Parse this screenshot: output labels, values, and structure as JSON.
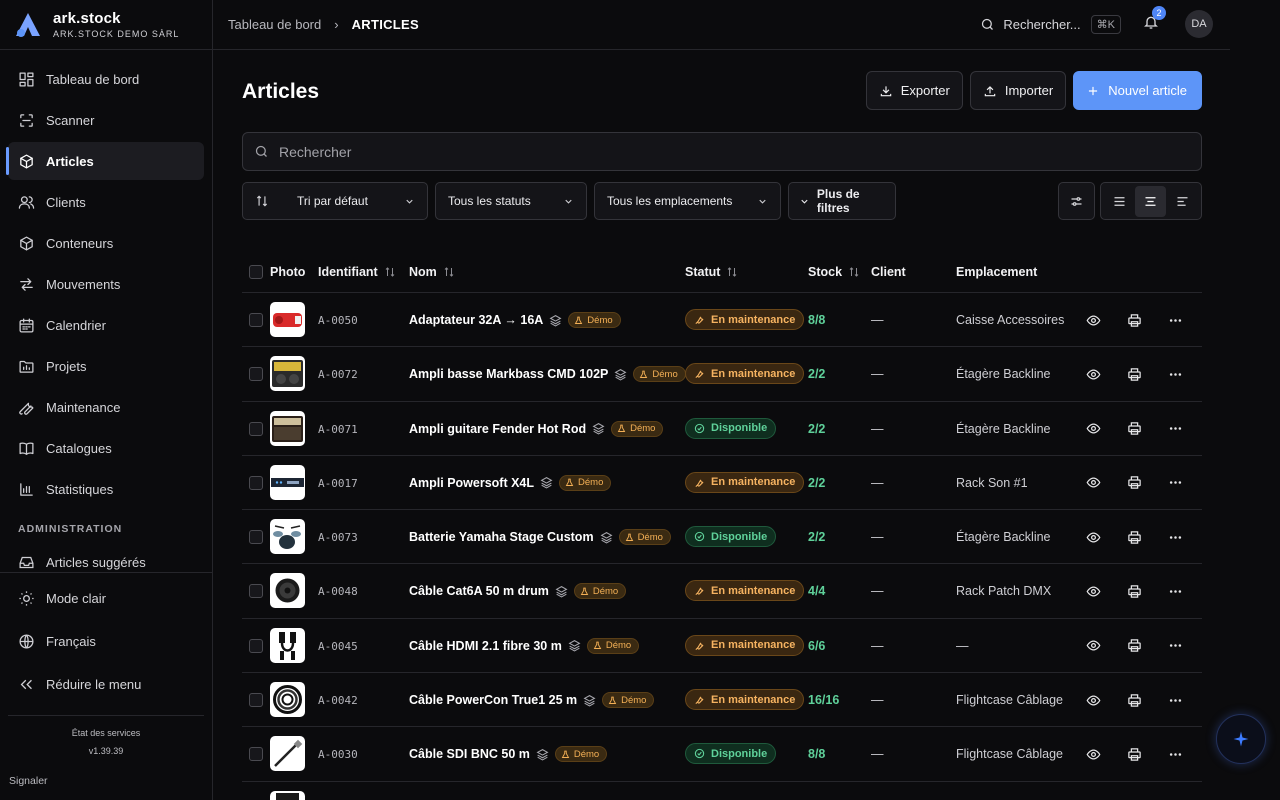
{
  "brand": {
    "name": "ark.stock",
    "subtitle": "ARK.STOCK DEMO SÀRL"
  },
  "sidebar": {
    "items": [
      {
        "label": "Tableau de bord",
        "icon": "dashboard-icon"
      },
      {
        "label": "Scanner",
        "icon": "scan-icon"
      },
      {
        "label": "Articles",
        "icon": "box-icon",
        "active": true
      },
      {
        "label": "Clients",
        "icon": "users-icon"
      },
      {
        "label": "Conteneurs",
        "icon": "container-icon"
      },
      {
        "label": "Mouvements",
        "icon": "arrows-icon"
      },
      {
        "label": "Calendrier",
        "icon": "calendar-icon"
      },
      {
        "label": "Projets",
        "icon": "folder-icon"
      },
      {
        "label": "Maintenance",
        "icon": "wrench-icon"
      },
      {
        "label": "Catalogues",
        "icon": "book-icon"
      },
      {
        "label": "Statistiques",
        "icon": "chart-icon"
      }
    ],
    "admin_section": "ADMINISTRATION",
    "admin_items": [
      {
        "label": "Articles suggérés",
        "icon": "inbox-icon"
      }
    ],
    "bottom": {
      "theme": "Mode clair",
      "language": "Français",
      "collapse": "Réduire le menu"
    },
    "service_status": "État des services",
    "version": "v1.39.39",
    "report": "Signaler"
  },
  "topbar": {
    "breadcrumb_root": "Tableau de bord",
    "breadcrumb_current": "ARTICLES",
    "search_label": "Rechercher...",
    "shortcut": "⌘K",
    "notifications": "2",
    "avatar": "DA"
  },
  "page": {
    "title": "Articles",
    "export_label": "Exporter",
    "import_label": "Importer",
    "new_label": "Nouvel article",
    "search_placeholder": "Rechercher"
  },
  "filters": {
    "sort": "Tri par défaut",
    "status": "Tous les statuts",
    "location": "Tous les emplacements",
    "more": "Plus de filtres"
  },
  "table": {
    "columns": {
      "photo": "Photo",
      "id": "Identifiant",
      "name": "Nom",
      "status": "Statut",
      "stock": "Stock",
      "client": "Client",
      "location": "Emplacement"
    },
    "demo_badge": "Démo",
    "rows": [
      {
        "id": "A-0050",
        "name": "Adaptateur 32A → 16A",
        "status": "En maintenance",
        "status_kind": "maint",
        "stock": "8/8",
        "client": "—",
        "location": "Caisse Accessoires",
        "thumb": "adapter"
      },
      {
        "id": "A-0072",
        "name": "Ampli basse Markbass CMD 102P",
        "status": "En maintenance",
        "status_kind": "maint",
        "stock": "2/2",
        "client": "—",
        "location": "Étagère Backline",
        "thumb": "bassamp"
      },
      {
        "id": "A-0071",
        "name": "Ampli guitare Fender Hot Rod",
        "status": "Disponible",
        "status_kind": "disp",
        "stock": "2/2",
        "client": "—",
        "location": "Étagère Backline",
        "thumb": "guitaramp"
      },
      {
        "id": "A-0017",
        "name": "Ampli Powersoft X4L",
        "status": "En maintenance",
        "status_kind": "maint",
        "stock": "2/2",
        "client": "—",
        "location": "Rack Son #1",
        "thumb": "rackamp"
      },
      {
        "id": "A-0073",
        "name": "Batterie Yamaha Stage Custom",
        "status": "Disponible",
        "status_kind": "disp",
        "stock": "2/2",
        "client": "—",
        "location": "Étagère Backline",
        "thumb": "drums"
      },
      {
        "id": "A-0048",
        "name": "Câble Cat6A 50 m drum",
        "status": "En maintenance",
        "status_kind": "maint",
        "stock": "4/4",
        "client": "—",
        "location": "Rack Patch DMX",
        "thumb": "drum"
      },
      {
        "id": "A-0045",
        "name": "Câble HDMI 2.1 fibre 30 m",
        "status": "En maintenance",
        "status_kind": "maint",
        "stock": "6/6",
        "client": "—",
        "location": "—",
        "thumb": "hdmi"
      },
      {
        "id": "A-0042",
        "name": "Câble PowerCon True1 25 m",
        "status": "En maintenance",
        "status_kind": "maint",
        "stock": "16/16",
        "client": "—",
        "location": "Flightcase Câblage",
        "thumb": "coil"
      },
      {
        "id": "A-0030",
        "name": "Câble SDI BNC 50 m",
        "status": "Disponible",
        "status_kind": "disp",
        "stock": "8/8",
        "client": "—",
        "location": "Flightcase Câblage",
        "thumb": "bnc"
      },
      {
        "id": "",
        "name": "",
        "status": "",
        "status_kind": "disp",
        "stock": "",
        "client": "",
        "location": "",
        "thumb": "partial"
      }
    ]
  },
  "colors": {
    "accent": "#5d95f8",
    "maintenance": "#f6b361",
    "available": "#5fd19a",
    "demo": "#f4b056"
  }
}
